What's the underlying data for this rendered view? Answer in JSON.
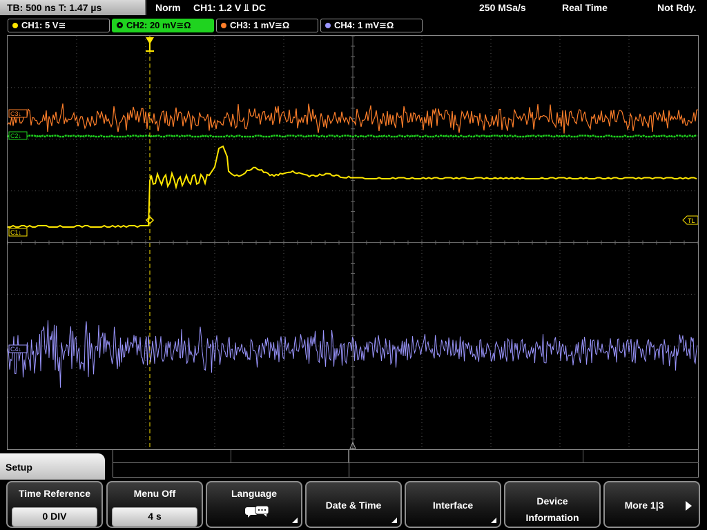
{
  "status_bar": {
    "timebase": "TB: 500 ns   T: 1.47 µs",
    "mode": "Norm",
    "trigger": "CH1: 1.2 V ⫫ DC",
    "sample_rate": "250 MSa/s",
    "acq_mode": "Real Time",
    "ready_state": "Not Rdy."
  },
  "channels": [
    {
      "label": "CH1: 5 V≅",
      "color": "#ffe600"
    },
    {
      "label": "CH2: 20 mV≅Ω",
      "color": "#1fd31f"
    },
    {
      "label": "CH3: 1 mV≅Ω",
      "color": "#ff7f2a"
    },
    {
      "label": "CH4: 1 mV≅Ω",
      "color": "#9b96ff"
    }
  ],
  "markers": {
    "ch1": "C1↓",
    "ch2": "C2↓",
    "ch3": "C3↓",
    "ch4": "C4↓",
    "trigger_level": "TL"
  },
  "colors": {
    "ch1": "#ffe600",
    "ch2": "#1fd31f",
    "ch3": "#ff7f2a",
    "ch4": "#9b96ff",
    "grid": "#5a5a5a"
  },
  "menu": {
    "title": "Setup",
    "softkeys": [
      {
        "label": "Time Reference",
        "value": "0 DIV"
      },
      {
        "label": "Menu Off",
        "value": "4 s"
      },
      {
        "label": "Language",
        "icon": "speech-bubbles-icon"
      },
      {
        "label": "Date & Time"
      },
      {
        "label": "Interface"
      },
      {
        "label_line1": "Device",
        "label_line2": "Information"
      },
      {
        "label": "More 1|3",
        "icon": "next-arrow-icon"
      }
    ]
  }
}
